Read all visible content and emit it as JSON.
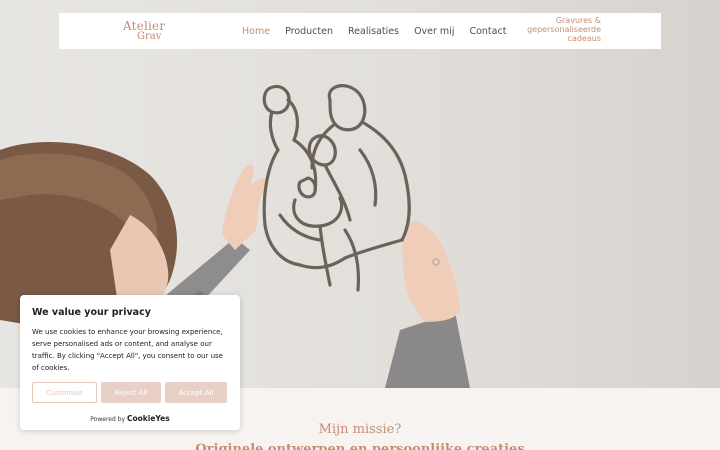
{
  "header": {
    "logo_line1": "Atelier",
    "logo_line2": "Grav",
    "nav": [
      {
        "label": "Home",
        "active": true
      },
      {
        "label": "Producten"
      },
      {
        "label": "Realisaties"
      },
      {
        "label": "Over mij"
      },
      {
        "label": "Contact"
      }
    ],
    "tagline": "Gravures & gepersonaliseerde cadeaus"
  },
  "hero": {
    "image": "woman-hanging-wooden-family-line-art"
  },
  "mission": {
    "title": "Mijn missie?",
    "subtitle": "Originele ontwerpen en persoonlijke creaties"
  },
  "cookie_banner": {
    "title": "We value your privacy",
    "text": "We use cookies to enhance your browsing experience, serve personalised ads or content, and analyse our traffic. By clicking \"Accept All\", you consent to our use of cookies.",
    "customise_label": "Customise",
    "reject_label": "Reject All",
    "accept_label": "Accept All",
    "powered_by": "Powered by",
    "powered_brand": "CookieYes"
  },
  "colors": {
    "accent": "#c48e72",
    "nav_text": "#5a4a44",
    "button_fill": "#e9cfc5",
    "page_bg": "#f7f3f0"
  }
}
